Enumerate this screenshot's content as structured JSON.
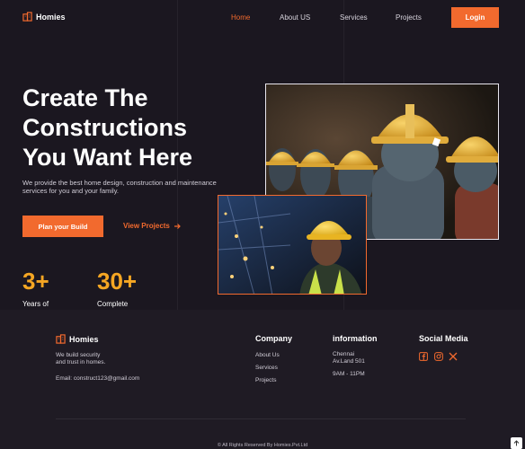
{
  "brand": {
    "name": "Homies",
    "accent": "#f26a2e",
    "stat_color": "#f5a623"
  },
  "nav": {
    "items": [
      {
        "label": "Home",
        "active": true
      },
      {
        "label": "About US",
        "active": false
      },
      {
        "label": "Services",
        "active": false
      },
      {
        "label": "Projects",
        "active": false
      }
    ],
    "login_label": "Login"
  },
  "hero": {
    "headline_line1": "Create The",
    "headline_line2": "Constructions",
    "headline_line3": "You Want Here",
    "subtext": "We provide the best home design, construction and maintenance services for you and your family.",
    "cta_primary": "Plan your Build",
    "cta_secondary": "View Projects",
    "stats": [
      {
        "value": "3+",
        "label": "Years of"
      },
      {
        "value": "30+",
        "label": "Complete"
      }
    ]
  },
  "footer": {
    "brand": "Homies",
    "tagline_line1": "We build security",
    "tagline_line2": "and trust in homes.",
    "email": "Email: construct123@gmail.com",
    "company": {
      "heading": "Company",
      "links": [
        "About Us",
        "Services",
        "Projects"
      ]
    },
    "information": {
      "heading": "information",
      "address_line1": "Chennai",
      "address_line2": "Av.Land 501",
      "hours": "9AM - 11PM"
    },
    "social": {
      "heading": "Social Media",
      "icons": [
        "facebook-icon",
        "instagram-icon",
        "x-icon"
      ]
    },
    "copyright": "© All Rights Reserved By Homies.Pvt.Ltd"
  }
}
